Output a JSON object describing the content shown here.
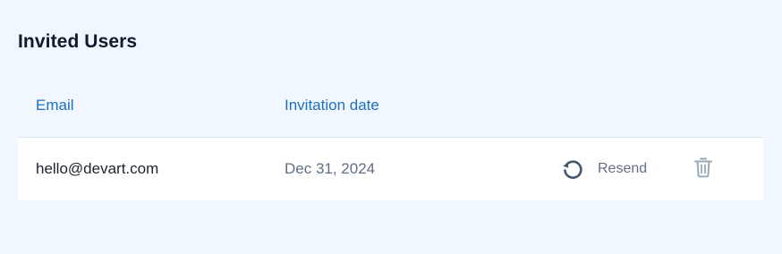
{
  "section": {
    "title": "Invited Users"
  },
  "table": {
    "columns": {
      "email": "Email",
      "invitation_date": "Invitation date"
    },
    "rows": [
      {
        "email": "hello@devart.com",
        "invitation_date": "Dec 31, 2024",
        "resend_label": "Resend",
        "resend_icon": "refresh-icon",
        "delete_icon": "trash-icon"
      }
    ]
  },
  "colors": {
    "background": "#f0f7fe",
    "header_text": "#1f6fc0",
    "title_text": "#0f1b2d",
    "row_background": "#ffffff",
    "muted_text": "#5f6f82",
    "icon_dark": "#46566b",
    "icon_light": "#9aa9ba"
  }
}
